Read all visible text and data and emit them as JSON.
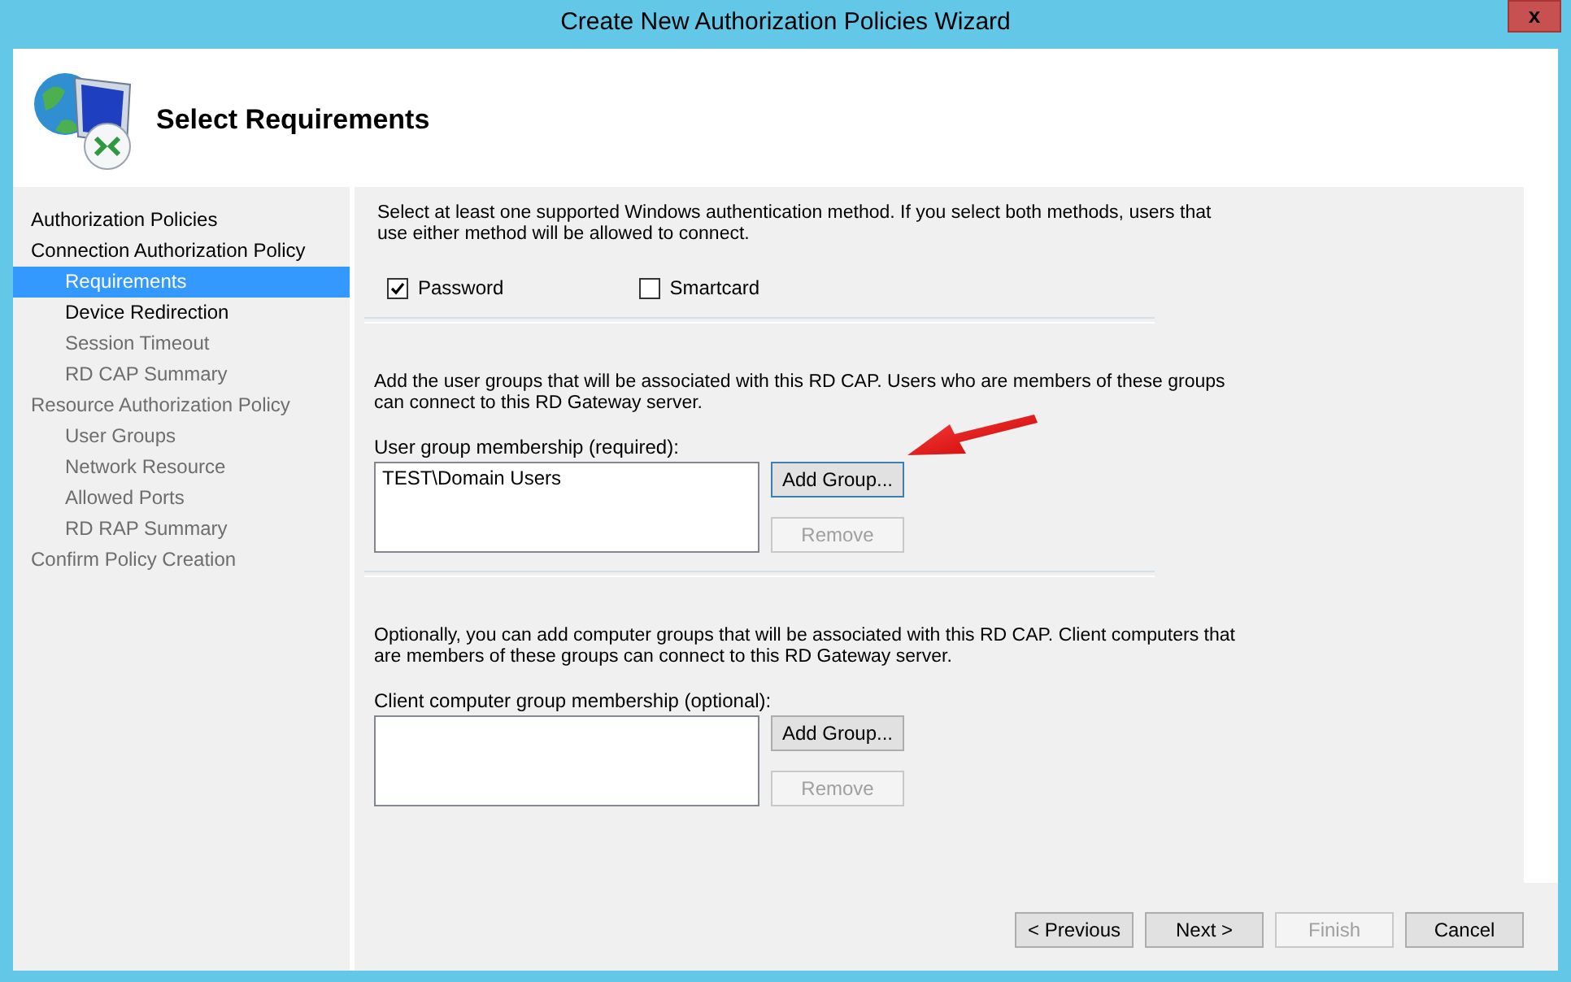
{
  "window": {
    "title": "Create New Authorization Policies Wizard",
    "close": "x"
  },
  "header": {
    "title": "Select Requirements"
  },
  "steps": [
    {
      "label": "Authorization Policies",
      "selected": false,
      "disabled": false
    },
    {
      "label": "Connection Authorization Policy",
      "selected": false,
      "disabled": false,
      "children": [
        {
          "label": "Requirements",
          "selected": true,
          "disabled": false
        },
        {
          "label": "Device Redirection",
          "selected": false,
          "disabled": false
        },
        {
          "label": "Session Timeout",
          "selected": false,
          "disabled": true
        },
        {
          "label": "RD CAP Summary",
          "selected": false,
          "disabled": true
        }
      ]
    },
    {
      "label": "Resource Authorization Policy",
      "selected": false,
      "disabled": true,
      "children": [
        {
          "label": "User Groups",
          "selected": false,
          "disabled": true
        },
        {
          "label": "Network Resource",
          "selected": false,
          "disabled": true
        },
        {
          "label": "Allowed Ports",
          "selected": false,
          "disabled": true
        },
        {
          "label": "RD RAP Summary",
          "selected": false,
          "disabled": true
        }
      ]
    },
    {
      "label": "Confirm Policy Creation",
      "selected": false,
      "disabled": true
    }
  ],
  "auth": {
    "text": "Select at least one supported Windows authentication method. If you select both methods, users that use either method will be allowed to connect.",
    "options": [
      {
        "label": "Password",
        "checked": true
      },
      {
        "label": "Smartcard",
        "checked": false
      }
    ]
  },
  "groups": [
    {
      "text": "Add the user groups that will be associated with this RD CAP. Users who are members of these groups can connect to this RD Gateway server.",
      "label": "User group membership (required):",
      "items": [
        "TEST\\Domain Users"
      ],
      "buttons": [
        {
          "label": "Add Group...",
          "disabled": false,
          "focused": true
        },
        {
          "label": "Remove",
          "disabled": true,
          "focused": false
        }
      ]
    },
    {
      "text": "Optionally, you can add computer groups that will be associated with this RD CAP. Client computers that are members of these groups can connect to this RD Gateway server.",
      "label": "Client computer group membership (optional):",
      "buttons": [
        {
          "label": "Add Group...",
          "disabled": false,
          "focused": false
        },
        {
          "label": "Remove",
          "disabled": true,
          "focused": false
        }
      ]
    }
  ],
  "footer_buttons": [
    {
      "label": "< Previous",
      "disabled": false
    },
    {
      "label": "Next >",
      "disabled": false
    },
    {
      "label": "Finish",
      "disabled": true
    },
    {
      "label": "Cancel",
      "disabled": false
    }
  ]
}
